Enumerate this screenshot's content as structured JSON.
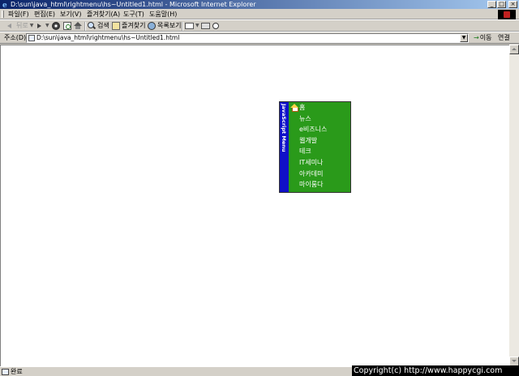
{
  "window": {
    "title": "D:\\sun\\java_html\\rightmenu\\hs~Untitled1.html - Microsoft Internet Explorer",
    "buttons": [
      "_",
      "□",
      "×"
    ]
  },
  "menubar": {
    "items": [
      "파일(F)",
      "편집(E)",
      "보기(V)",
      "즐겨찾기(A)",
      "도구(T)",
      "도움말(H)"
    ]
  },
  "toolbar": {
    "back_label": "뒤로",
    "search_label": "검색",
    "favorites_label": "즐겨찾기",
    "history_label": "목록보기"
  },
  "addressbar": {
    "label": "주소(D)",
    "url": "D:\\sun\\java_html\\rightmenu\\hs~Untitled1.html",
    "go_label": "이동",
    "links_label": "연결"
  },
  "js_menu": {
    "side_title": "JavaScript Menu",
    "bg_color": "#2a9a1a",
    "side_color": "#1010c8",
    "items": [
      "홈",
      "뉴스",
      "e비즈니스",
      "웹개발",
      "테크",
      "IT세미나",
      "아카데미",
      "마이룸다"
    ]
  },
  "statusbar": {
    "text": "완료"
  },
  "watermark": {
    "text": "Copyright(c) http://www.happycgi.com"
  }
}
